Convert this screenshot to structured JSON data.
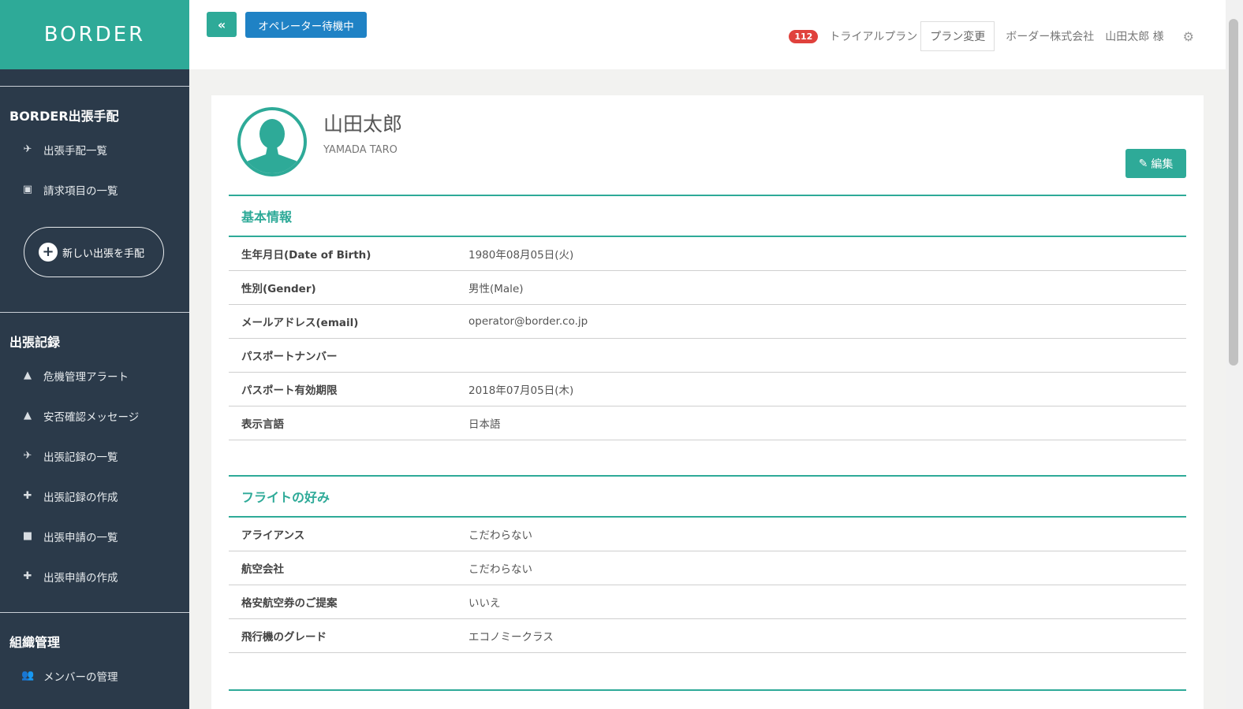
{
  "brand": {
    "logo_text": "BORDER",
    "accent": "#2eaa98",
    "sidebar_bg": "#2b3a4a"
  },
  "sidebar": {
    "sections": [
      {
        "heading": "BORDER出張手配",
        "items": [
          {
            "label": "出張手配一覧",
            "icon": "airplane-icon"
          },
          {
            "label": "請求項目の一覧",
            "icon": "money-icon"
          }
        ],
        "new_trip_label": "新しい出張を手配"
      },
      {
        "heading": "出張記録",
        "items": [
          {
            "label": "危機管理アラート",
            "icon": "warning-icon"
          },
          {
            "label": "安否確認メッセージ",
            "icon": "warning-icon"
          },
          {
            "label": "出張記録の一覧",
            "icon": "airplane-icon"
          },
          {
            "label": "出張記録の作成",
            "icon": "plus-icon"
          },
          {
            "label": "出張申請の一覧",
            "icon": "briefcase-icon"
          },
          {
            "label": "出張申請の作成",
            "icon": "plus-icon"
          }
        ]
      },
      {
        "heading": "組織管理",
        "items": [
          {
            "label": "メンバーの管理",
            "icon": "users-icon"
          }
        ]
      }
    ]
  },
  "header": {
    "back_label": "«",
    "operator_status": "オペレーター待機中",
    "notification_count": "112",
    "plan_name": "トライアルプラン",
    "plan_change_label": "プラン変更",
    "company": "ボーダー株式会社",
    "user": "山田太郎 様"
  },
  "profile": {
    "name": "山田太郎",
    "name_roman": "YAMADA TARO",
    "edit_label": "編集"
  },
  "basic_info": {
    "title": "基本情報",
    "rows": [
      {
        "label": "生年月日(Date of Birth)",
        "value": "1980年08月05日(火)"
      },
      {
        "label": "性別(Gender)",
        "value": "男性(Male)"
      },
      {
        "label": "メールアドレス(email)",
        "value": "operator@border.co.jp"
      },
      {
        "label": "パスポートナンバー",
        "value": ""
      },
      {
        "label": "パスポート有効期限",
        "value": "2018年07月05日(木)"
      },
      {
        "label": "表示言語",
        "value": "日本語"
      }
    ]
  },
  "flight_pref": {
    "title": "フライトの好み",
    "rows": [
      {
        "label": "アライアンス",
        "value": "こだわらない"
      },
      {
        "label": "航空会社",
        "value": "こだわらない"
      },
      {
        "label": "格安航空券のご提案",
        "value": "いいえ"
      },
      {
        "label": "飛行機のグレード",
        "value": "エコノミークラス"
      }
    ]
  }
}
